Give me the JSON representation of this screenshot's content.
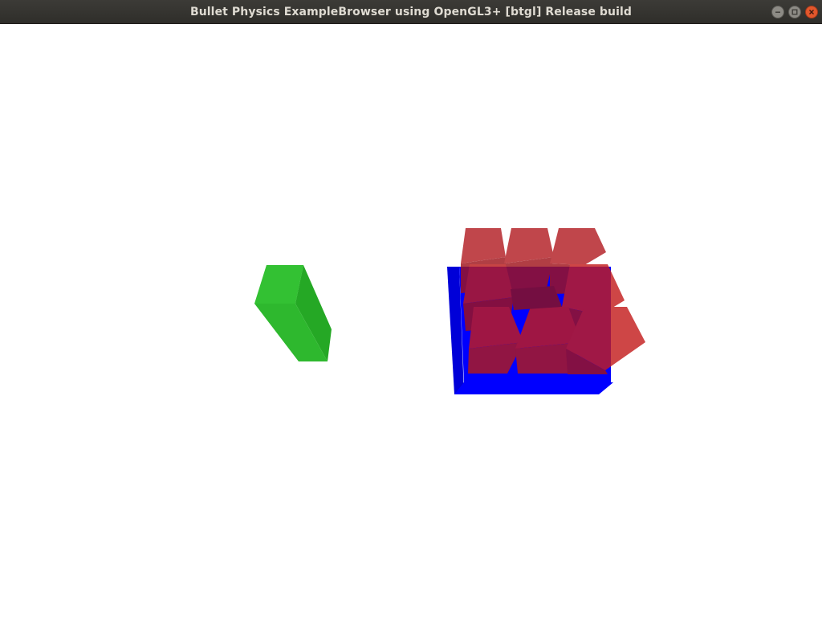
{
  "window": {
    "title": "Bullet Physics ExampleBrowser using OpenGL3+ [btgl] Release build",
    "controls": {
      "minimize_icon": "minimize-icon",
      "maximize_icon": "maximize-icon",
      "close_icon": "close-icon"
    }
  },
  "scene": {
    "background": "#ffffff",
    "colors": {
      "green_object": "#2eb82e",
      "blue_ground": "#0000ff",
      "red_cubes": "#c41e1e"
    },
    "red_cube_count": 9
  }
}
